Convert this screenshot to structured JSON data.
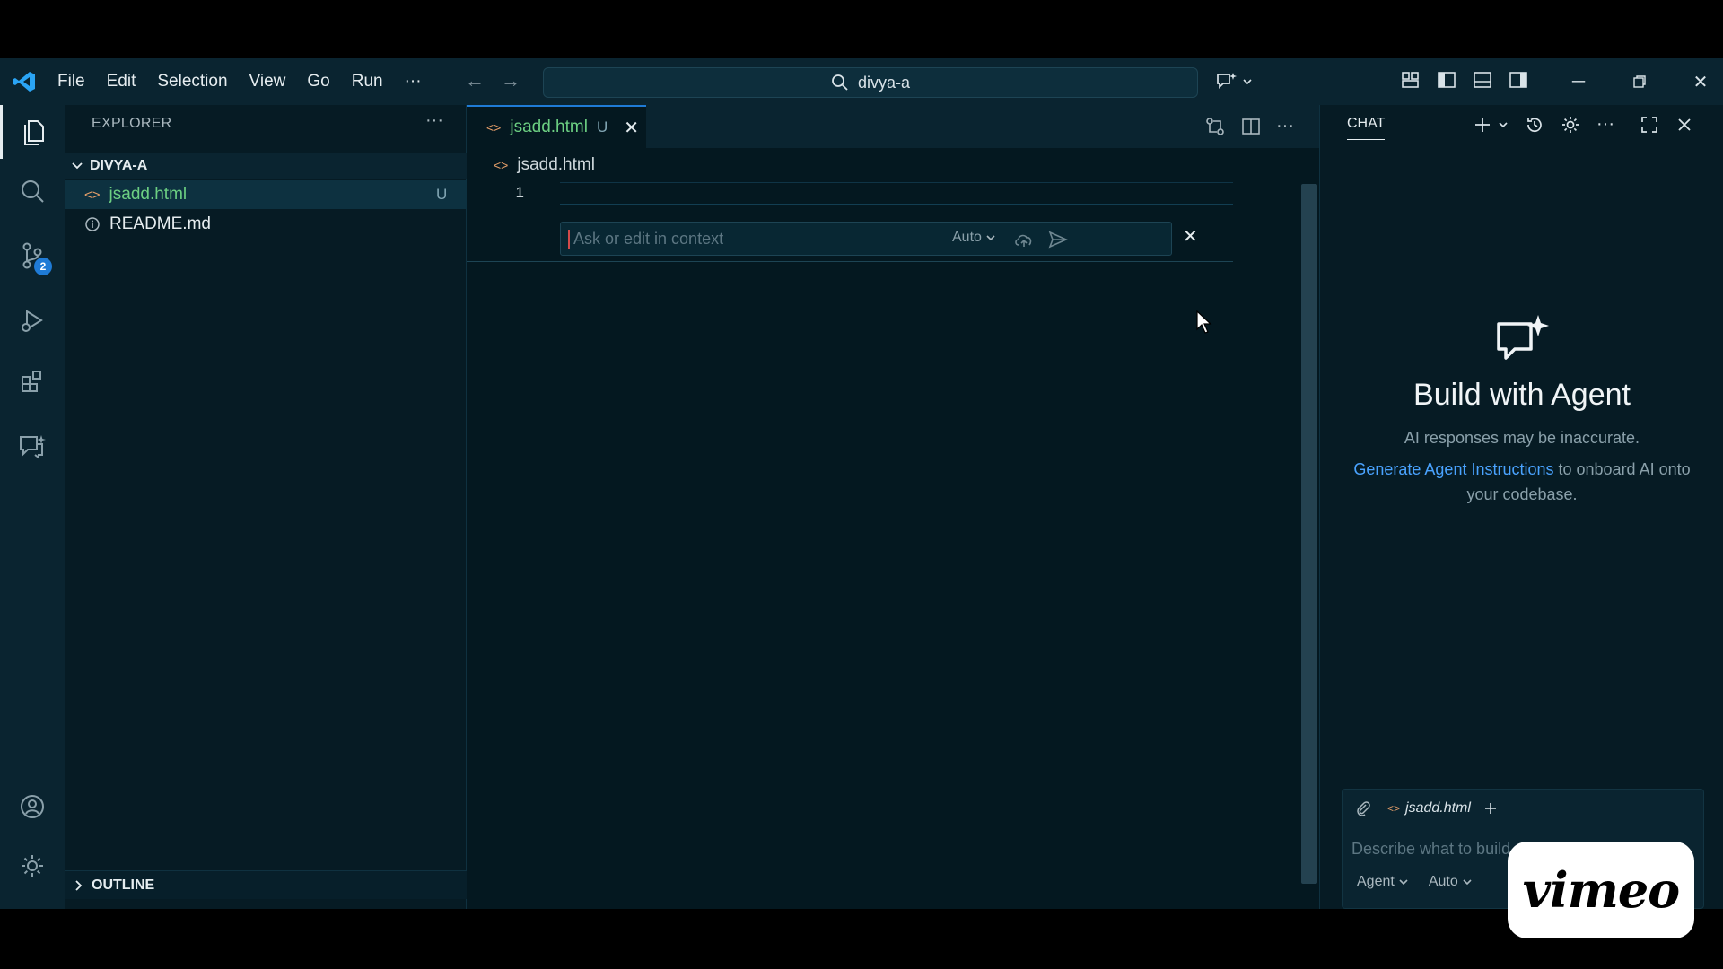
{
  "menu": [
    "File",
    "Edit",
    "Selection",
    "View",
    "Go",
    "Run",
    "···"
  ],
  "command_center": {
    "label": "divya-a"
  },
  "activity_bar": {
    "source_control_badge": "2"
  },
  "explorer": {
    "header": "EXPLORER",
    "more": "···",
    "folder": "DIVYA-A",
    "files": [
      {
        "name": "jsadd.html",
        "status": "U",
        "icon": "html-icon",
        "color": "#6ccf82"
      },
      {
        "name": "README.md",
        "status": "",
        "icon": "info-icon",
        "color": "#e6edf0"
      }
    ],
    "outline": "OUTLINE"
  },
  "editor": {
    "tab": {
      "title": "jsadd.html",
      "status": "U"
    },
    "breadcrumb": "jsadd.html",
    "line_number": "1",
    "inline_chat": {
      "placeholder": "Ask or edit in context",
      "mode": "Auto"
    },
    "more": "···"
  },
  "chat": {
    "title": "CHAT",
    "more": "···",
    "hero_title": "Build with Agent",
    "hero_sub": "AI responses may be inaccurate.",
    "link_text": "Generate Agent Instructions",
    "link_suffix": " to onboard AI onto your codebase.",
    "attached_file": "jsadd.html",
    "input_placeholder": "Describe what to build",
    "mode": "Agent",
    "model": "Auto"
  },
  "watermark": "vimeo",
  "colors": {
    "accent": "#1f7bd6",
    "link": "#4aa3ff",
    "untracked": "#6ccf82"
  }
}
